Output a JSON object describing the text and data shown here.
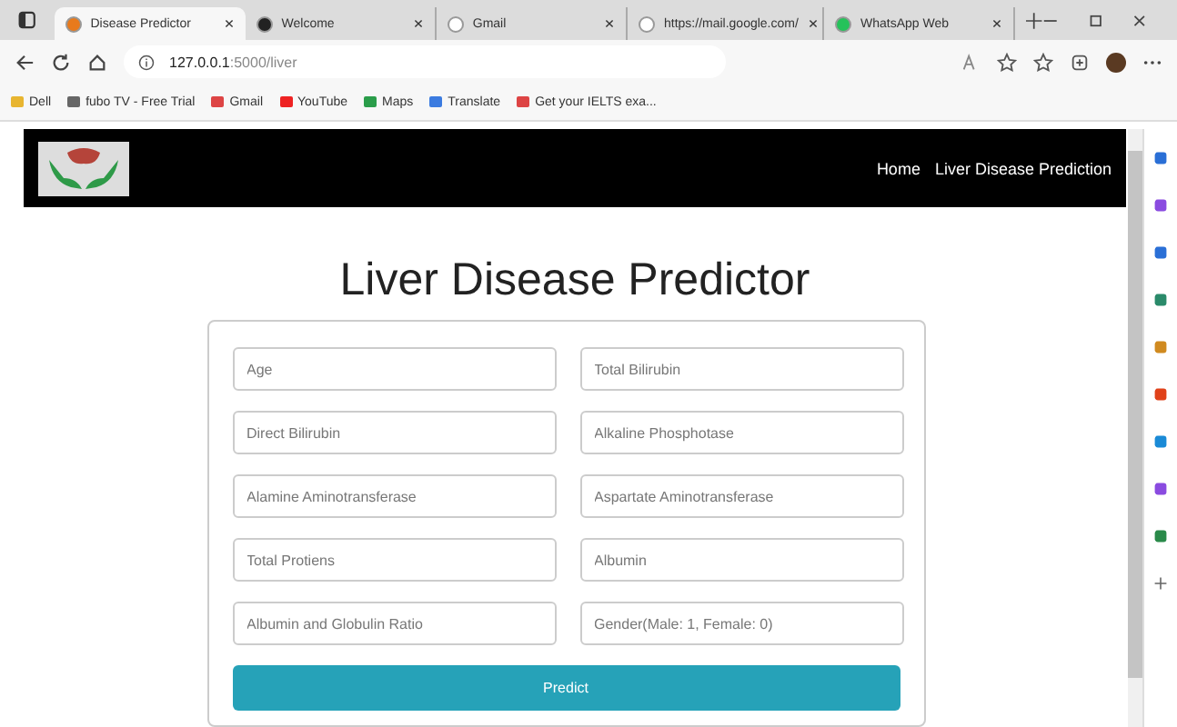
{
  "tabs": [
    {
      "label": "Disease Predictor",
      "selected": true
    },
    {
      "label": "Welcome",
      "selected": false
    },
    {
      "label": "Gmail",
      "selected": false
    },
    {
      "label": "https://mail.google.com/",
      "selected": false
    },
    {
      "label": "WhatsApp Web",
      "selected": false
    }
  ],
  "address": {
    "host": "127.0.0.1",
    "path": ":5000/liver"
  },
  "bookmarks": [
    "Dell",
    "fubo TV - Free Trial",
    "Gmail",
    "YouTube",
    "Maps",
    "Translate",
    "Get your IELTS exa..."
  ],
  "nav": [
    "Home",
    "Liver Disease Prediction"
  ],
  "heading": "Liver Disease Predictor",
  "fields": [
    {
      "placeholder": "Age"
    },
    {
      "placeholder": "Total Bilirubin"
    },
    {
      "placeholder": "Direct Bilirubin"
    },
    {
      "placeholder": "Alkaline Phosphotase"
    },
    {
      "placeholder": "Alamine Aminotransferase"
    },
    {
      "placeholder": "Aspartate Aminotransferase"
    },
    {
      "placeholder": "Total Protiens"
    },
    {
      "placeholder": "Albumin"
    },
    {
      "placeholder": "Albumin and Globulin Ratio"
    },
    {
      "placeholder": "Gender(Male: 1, Female: 0)"
    }
  ],
  "button": "Predict"
}
